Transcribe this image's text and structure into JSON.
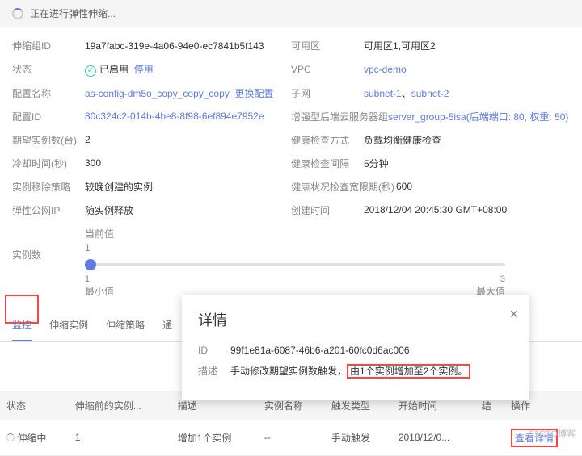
{
  "banner": {
    "text": "正在进行弹性伸缩..."
  },
  "left": {
    "group_id_lbl": "伸缩组ID",
    "group_id": "19a7fabc-319e-4a06-94e0-ec7841b5f143",
    "status_lbl": "状态",
    "status_val": "已启用",
    "status_action": "停用",
    "config_name_lbl": "配置名称",
    "config_name": "as-config-dm5o_copy_copy_copy",
    "update_config": "更换配置",
    "config_id_lbl": "配置ID",
    "config_id": "80c324c2-014b-4be8-8f98-6ef894e7952e",
    "expected_lbl": "期望实例数(台)",
    "expected": "2",
    "cooldown_lbl": "冷却时间(秒)",
    "cooldown": "300",
    "remove_policy_lbl": "实例移除策略",
    "remove_policy": "较晚创建的实例",
    "eip_lbl": "弹性公网IP",
    "eip": "随实例释放"
  },
  "right": {
    "az_lbl": "可用区",
    "az": "可用区1,可用区2",
    "vpc_lbl": "VPC",
    "vpc": "vpc-demo",
    "subnet_lbl": "子网",
    "subnet1": "subnet-1",
    "subnet2": "subnet-2",
    "backend_lbl": "增强型后端云服务器组",
    "backend": "server_group-5isa(后端端口: 80, 权重: 50)",
    "health_method_lbl": "健康检查方式",
    "health_method": "负载均衡健康检查",
    "health_interval_lbl": "健康检查间隔",
    "health_interval": "5分钟",
    "health_grace_lbl": "健康状况检查宽限期(秒)",
    "health_grace": "600",
    "created_lbl": "创建时间",
    "created": "2018/12/04 20:45:30 GMT+08:00"
  },
  "instances": {
    "lbl": "实例数",
    "current_lbl": "当前值",
    "cur_num": "1",
    "min": "1",
    "max": "3",
    "min_lbl": "最小值",
    "max_lbl": "最大值"
  },
  "tabs": {
    "t1": "监控",
    "t2": "伸缩实例",
    "t3": "伸缩策略",
    "t4": "通"
  },
  "modal": {
    "title": "详情",
    "id_lbl": "ID",
    "id": "99f1e81a-6087-46b6-a201-60fc0d6ac006",
    "desc_lbl": "描述",
    "desc_a": "手动修改期望实例数触发，",
    "desc_b": "由1个实例增加至2个实例。"
  },
  "table": {
    "h_status": "状态",
    "h_before": "伸缩前的实例...",
    "h_desc": "描述",
    "h_name": "实例名称",
    "h_type": "触发类型",
    "h_start": "开始时间",
    "h_end": "结",
    "h_op": "操作",
    "r_status": "伸缩中",
    "r_before": "1",
    "r_desc": "增加1个实例",
    "r_name": "--",
    "r_type": "手动触发",
    "r_start": "2018/12/0...",
    "r_op": "查看详情"
  },
  "watermark": "51CTO博客"
}
